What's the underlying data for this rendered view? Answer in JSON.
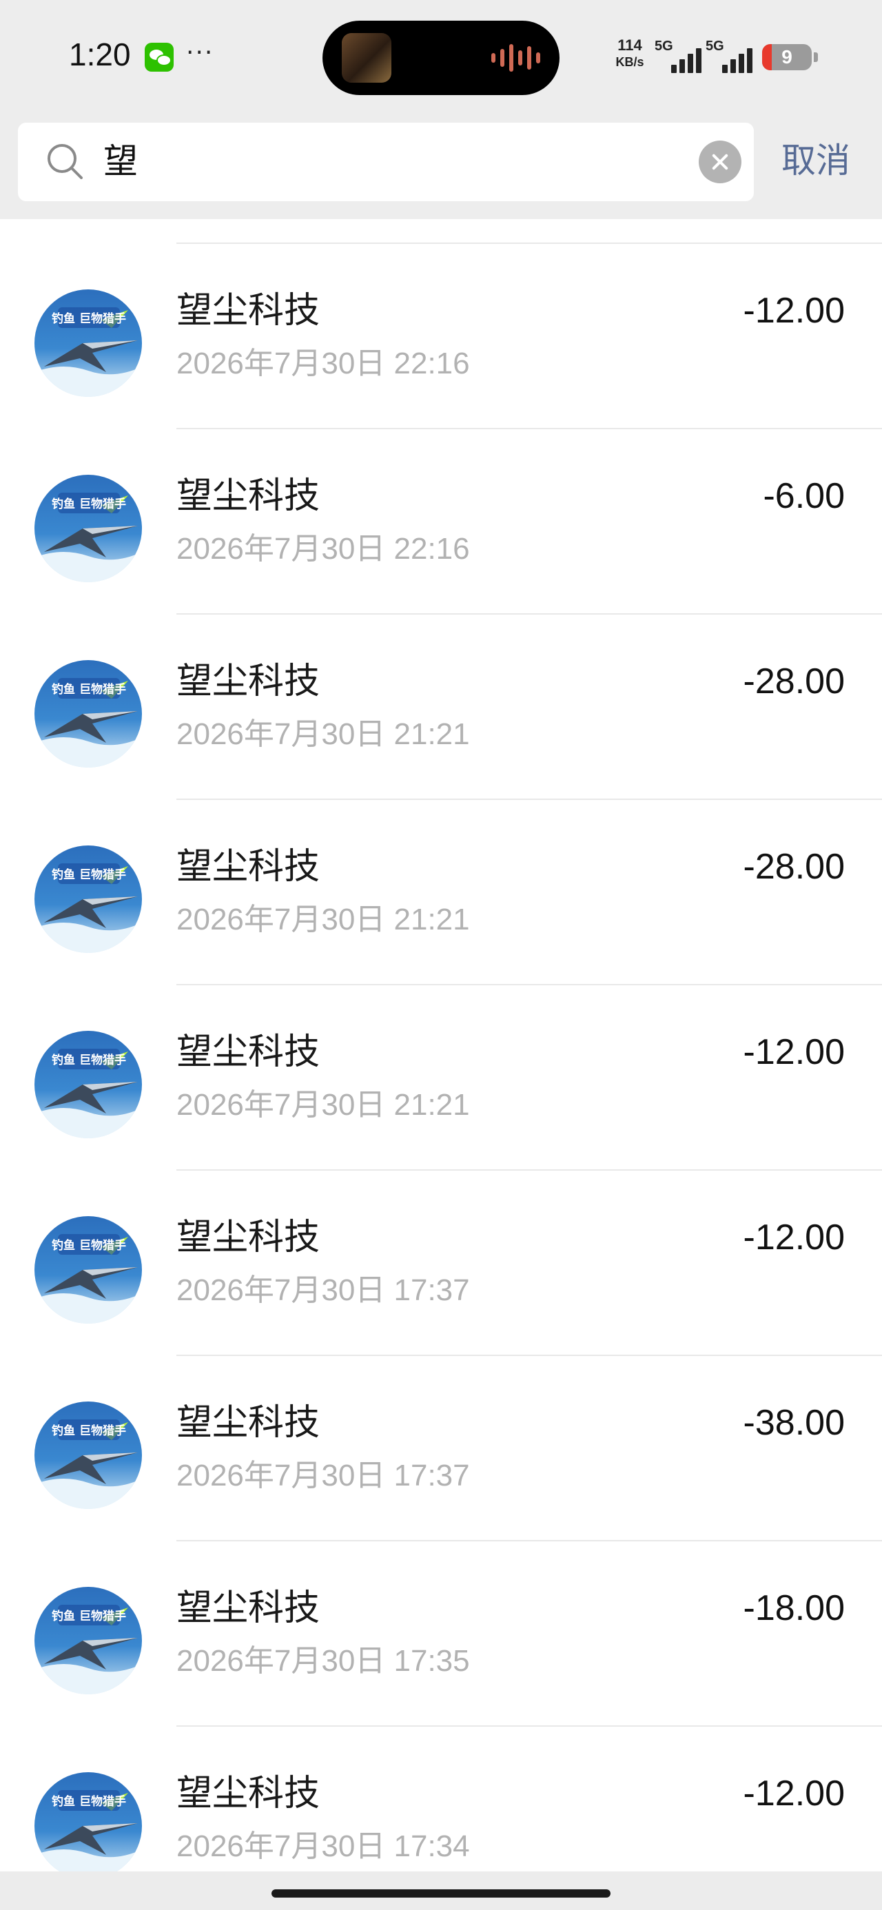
{
  "status_bar": {
    "time": "1:20",
    "icons": [
      "wechat-icon",
      "more-dots-icon",
      "music-thumbnail-icon",
      "audio-wave-icon",
      "signal-icon",
      "battery-icon"
    ],
    "more": "···",
    "net_speed_value": "114",
    "net_speed_unit": "KB/s",
    "sim1_type": "5G",
    "sim2_type": "5G",
    "battery_level": "9"
  },
  "search": {
    "query": "望",
    "cancel_label": "取消",
    "icons": [
      "search-icon",
      "clear-icon"
    ]
  },
  "transactions": [
    {
      "merchant": "望尘科技",
      "date": "2026年7月30日 22:16",
      "amount": "-12.00"
    },
    {
      "merchant": "望尘科技",
      "date": "2026年7月30日 22:16",
      "amount": "-6.00"
    },
    {
      "merchant": "望尘科技",
      "date": "2026年7月30日 21:21",
      "amount": "-28.00"
    },
    {
      "merchant": "望尘科技",
      "date": "2026年7月30日 21:21",
      "amount": "-28.00"
    },
    {
      "merchant": "望尘科技",
      "date": "2026年7月30日 21:21",
      "amount": "-12.00"
    },
    {
      "merchant": "望尘科技",
      "date": "2026年7月30日 17:37",
      "amount": "-12.00"
    },
    {
      "merchant": "望尘科技",
      "date": "2026年7月30日 17:37",
      "amount": "-38.00"
    },
    {
      "merchant": "望尘科技",
      "date": "2026年7月30日 17:35",
      "amount": "-18.00"
    },
    {
      "merchant": "望尘科技",
      "date": "2026年7月30日 17:34",
      "amount": "-12.00"
    }
  ],
  "avatar_logo_text": "钓鱼 巨物猎手",
  "colors": {
    "header_bg": "#ededed",
    "cancel_text": "#576b95",
    "date_text": "#b2b2b2",
    "battery_low": "#e8392c"
  }
}
